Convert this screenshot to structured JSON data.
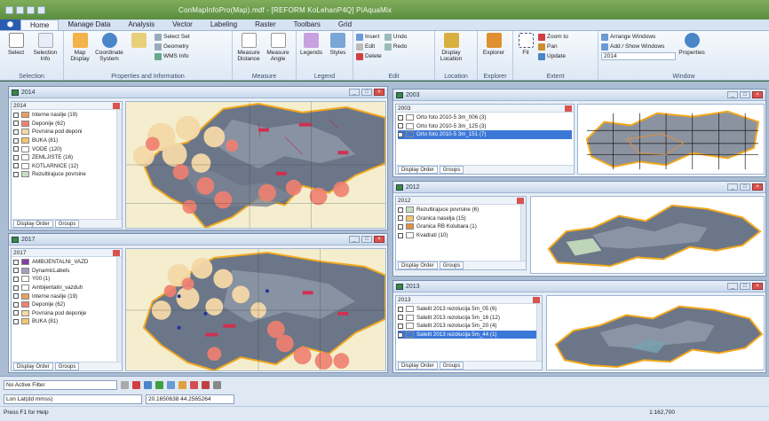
{
  "app": {
    "title": "ConMapInfoPro(Map).mdf - [REFORM KoLehanP4Q] PiAquaMix",
    "file_tab": "⬢",
    "tabs": [
      "Home",
      "Manage Data",
      "Analysis",
      "Vector",
      "Labeling",
      "Raster",
      "Toolbars",
      "Grid"
    ],
    "active_tab": "Home"
  },
  "ribbon": {
    "groups": [
      {
        "label": "Selection",
        "buttons": [
          "Select",
          "Selection Info"
        ]
      },
      {
        "label": "Properties and Information",
        "buttons": [
          "Map Display",
          "Coordinate System",
          "WMS Info"
        ],
        "small": [
          "Select Set",
          "Geometry",
          "WMS Info"
        ]
      },
      {
        "label": "Measure",
        "buttons": [
          "Measure Distance",
          "Measure Angle"
        ]
      },
      {
        "label": "Legend",
        "buttons": [
          "Legends",
          "Styles"
        ]
      },
      {
        "label": "Edit",
        "small": [
          "Insert",
          "Edit",
          "Delete",
          "Undo",
          "Redo"
        ]
      },
      {
        "label": "Location",
        "buttons": [
          "Display Location"
        ]
      },
      {
        "label": "Explorer",
        "buttons": [
          "Explorer"
        ]
      },
      {
        "label": "Extent",
        "buttons": [
          "Fit"
        ],
        "small": [
          "Zoom to",
          "Pan",
          "Update"
        ]
      },
      {
        "label": "Window",
        "small": [
          "Arrange Windows",
          "Add / Show Windows"
        ],
        "combo": "2014",
        "buttons": [
          "Properties"
        ]
      }
    ]
  },
  "windows": [
    {
      "name": "2014",
      "legend_header": "2014",
      "rows": [
        {
          "label": "Interne nasilje (19)",
          "color": "#e8a060"
        },
        {
          "label": "Deponije (62)",
          "color": "#f08070"
        },
        {
          "label": "Povrsina pod deponi",
          "color": "#f5d8a8"
        },
        {
          "label": "BUKA (81)",
          "color": "#f5c570"
        },
        {
          "label": "VODE (120)",
          "color": "#ffffff"
        },
        {
          "label": "ZEMLJISTE (16)",
          "color": "#ffffff"
        },
        {
          "label": "KOTLARNICE (12)",
          "color": "#ffffff"
        },
        {
          "label": "Rezultirajuce povrsine",
          "color": "#c8e0c0"
        }
      ],
      "footer": [
        "Display Order",
        "Groups"
      ]
    },
    {
      "name": "2017",
      "legend_header": "2017",
      "rows": [
        {
          "label": "AMBIJENTALNI_VAZD",
          "color": "#8040a0"
        },
        {
          "label": "DynamicLabels",
          "color": "#a0a0c0"
        },
        {
          "label": "Y00 (1)",
          "color": "#ffffff"
        },
        {
          "label": "Ambijentalni_vazduh",
          "color": "#ffffff"
        },
        {
          "label": "Interne nasilje (19)",
          "color": "#e8a060"
        },
        {
          "label": "Deponije (62)",
          "color": "#f08070"
        },
        {
          "label": "Povrsina pod deponije",
          "color": "#f5d8a8"
        },
        {
          "label": "BUKA (81)",
          "color": "#f5c570"
        }
      ],
      "footer": [
        "Display Order",
        "Groups"
      ]
    },
    {
      "name": "2003",
      "legend_header": "2003",
      "rows": [
        {
          "label": "Orto foto 2010-5 3m_006 (3)",
          "color": "#ffffff"
        },
        {
          "label": "Orto foto 2010-5 3m_125 (3)",
          "color": "#ffffff"
        },
        {
          "label": "Orto foto 2010-5 3m_151 (7)",
          "color": "#3c78d8",
          "selected": true
        }
      ],
      "footer": [
        "Display Order",
        "Groups"
      ]
    },
    {
      "name": "2012",
      "legend_header": "2012",
      "rows": [
        {
          "label": "Rezultirajuce povrsine (6)",
          "color": "#c8e0c0"
        },
        {
          "label": "Granica naselja (15)",
          "color": "#f5c570"
        },
        {
          "label": "Granica RB Kolubara (1)",
          "color": "#e09040"
        },
        {
          "label": "Kvadrati (10)",
          "color": "#ffffff"
        }
      ],
      "footer": [
        "Display Order",
        "Groups"
      ]
    },
    {
      "name": "2013",
      "legend_header": "2013",
      "rows": [
        {
          "label": "Satelit 2013 rezolucija 5m_05 (6)",
          "color": "#ffffff"
        },
        {
          "label": "Satelit 2013 rezolucija 5m_16 (12)",
          "color": "#ffffff"
        },
        {
          "label": "Satelit 2013 rezolucija 5m_20 (4)",
          "color": "#ffffff"
        },
        {
          "label": "Satelit 2013 rezolucija 5m_44 (1)",
          "color": "#3c78d8",
          "selected": true
        }
      ],
      "footer": [
        "Display Order",
        "Groups"
      ]
    }
  ],
  "bottom": {
    "active_filter": "No Active Filter",
    "coord_system": "Lon Lat(dd mmss)",
    "coords": "20.1650638 44.2565264",
    "status": "Press F1 for Help",
    "scale": "1:162,700"
  }
}
